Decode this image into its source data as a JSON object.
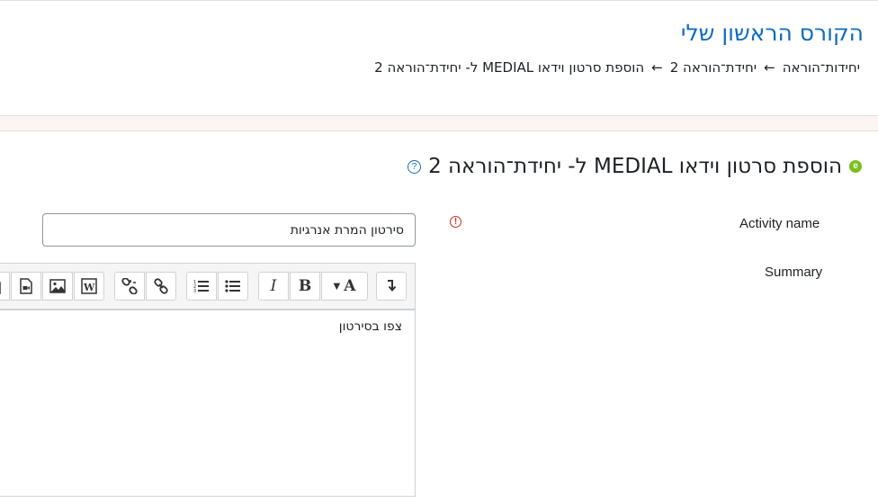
{
  "header": {
    "course_title": "הקורס הראשון שלי",
    "breadcrumb": [
      "יחידות־הוראה",
      "←",
      "יחידת־הוראה 2",
      "←",
      "הוספת סרטון וידאו MEDIAL ל- יחידת־הוראה 2"
    ]
  },
  "page": {
    "heading": "הוספת סרטון וידאו MEDIAL ל- יחידת־הוראה 2",
    "help_glyph": "?"
  },
  "form": {
    "activity_name_label": "Activity name",
    "required_glyph": "!",
    "activity_name_value": "סירטון המרת אנרגיות",
    "summary_label": "Summary",
    "summary_text": "צפו בסירטון"
  },
  "toolbar": {
    "bold": "B",
    "italic": "I",
    "text_color": "A"
  },
  "colors": {
    "link": "#0f6cbf",
    "required": "#ca3120",
    "module_icon": "#7bbf1f",
    "band": "#fbf5f3"
  }
}
